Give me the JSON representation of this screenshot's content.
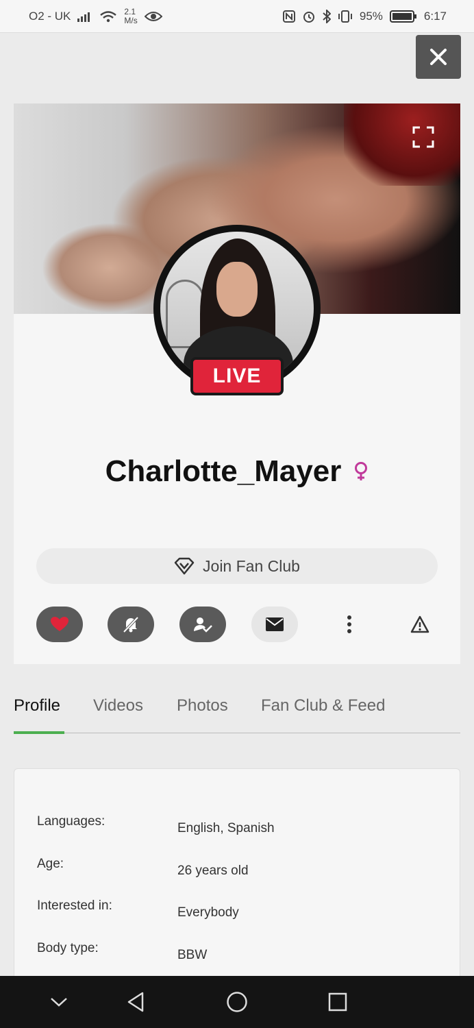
{
  "status_bar": {
    "carrier": "O2 - UK",
    "speed_value": "2.1",
    "speed_unit": "M/s",
    "battery": "95%",
    "time": "6:17"
  },
  "profile": {
    "username": "Charlotte_Mayer",
    "live_badge": "LIVE",
    "gender_icon": "female-symbol-icon",
    "join_fan_club": "Join Fan Club"
  },
  "tabs": [
    {
      "label": "Profile",
      "active": true
    },
    {
      "label": "Videos",
      "active": false
    },
    {
      "label": "Photos",
      "active": false
    },
    {
      "label": "Fan Club & Feed",
      "active": false
    }
  ],
  "info": [
    {
      "label": "Languages:",
      "value": "English, Spanish"
    },
    {
      "label": "Age:",
      "value": "26 years old"
    },
    {
      "label": "Interested in:",
      "value": "Everybody"
    },
    {
      "label": "Body type:",
      "value": "BBW"
    }
  ],
  "colors": {
    "live": "#e0243a",
    "accent": "#4caf50",
    "gender": "#c0399a"
  }
}
